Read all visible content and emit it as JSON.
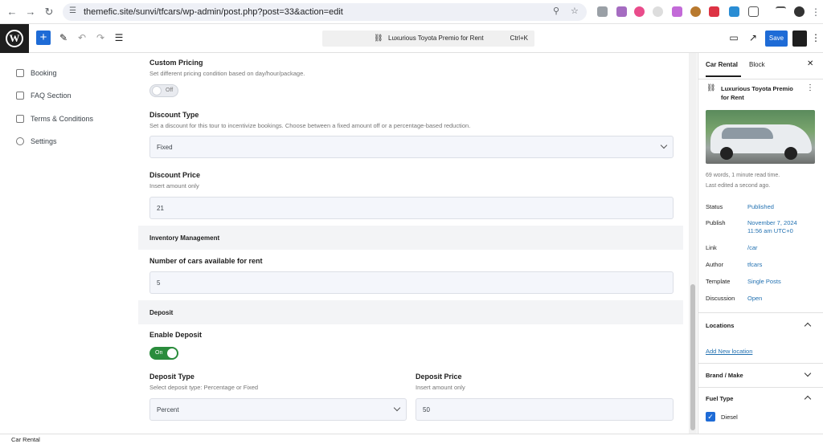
{
  "browser": {
    "url": "themefic.site/sunvi/tfcars/wp-admin/post.php?post=33&action=edit"
  },
  "toolbar": {
    "command_title": "Luxurious Toyota Premio for Rent",
    "command_shortcut": "Ctrl+K",
    "save_label": "Save"
  },
  "leftnav": {
    "items": [
      {
        "label": "Booking",
        "icon": "bike-icon"
      },
      {
        "label": "FAQ Section",
        "icon": "clipboard-icon"
      },
      {
        "label": "Terms & Conditions",
        "icon": "checkbox-icon"
      },
      {
        "label": "Settings",
        "icon": "gears-icon"
      }
    ]
  },
  "form": {
    "custom_pricing": {
      "label": "Custom Pricing",
      "help": "Set different pricing condition based on day/hour/package.",
      "toggle": "Off"
    },
    "discount_type": {
      "label": "Discount Type",
      "help": "Set a discount for this tour to incentivize bookings. Choose between a fixed amount off or a percentage-based reduction.",
      "value": "Fixed"
    },
    "discount_price": {
      "label": "Discount Price",
      "help": "Insert amount only",
      "value": "21"
    },
    "inventory_section": "Inventory Management",
    "cars_available": {
      "label": "Number of cars available for rent",
      "value": "5"
    },
    "deposit_section": "Deposit",
    "enable_deposit": {
      "label": "Enable Deposit",
      "toggle": "On"
    },
    "deposit_type": {
      "label": "Deposit Type",
      "help": "Select deposit type: Percentage or Fixed",
      "value": "Percent"
    },
    "deposit_price": {
      "label": "Deposit Price",
      "help": "Insert amount only",
      "value": "50"
    }
  },
  "sidebar": {
    "tabs": [
      "Car Rental",
      "Block"
    ],
    "post_title": "Luxurious Toyota Premio for Rent",
    "stats": "69 words, 1 minute read time.",
    "last_edited": "Last edited a second ago.",
    "rows": [
      {
        "label": "Status",
        "value": "Published"
      },
      {
        "label": "Publish",
        "value": "November 7, 2024\n11:56 am UTC+0"
      },
      {
        "label": "Link",
        "value": "/car"
      },
      {
        "label": "Author",
        "value": "tfcars"
      },
      {
        "label": "Template",
        "value": "Single Posts"
      },
      {
        "label": "Discussion",
        "value": "Open"
      }
    ],
    "locations": {
      "title": "Locations",
      "link": "Add New location"
    },
    "brand_make": "Brand / Make",
    "fuel_type": {
      "title": "Fuel Type",
      "option": "Diesel"
    }
  },
  "footer": {
    "breadcrumb": "Car Rental"
  },
  "colors": {
    "accent": "#1e6bd6",
    "toggle_on": "#2a8c3c",
    "link": "#2271b1"
  }
}
